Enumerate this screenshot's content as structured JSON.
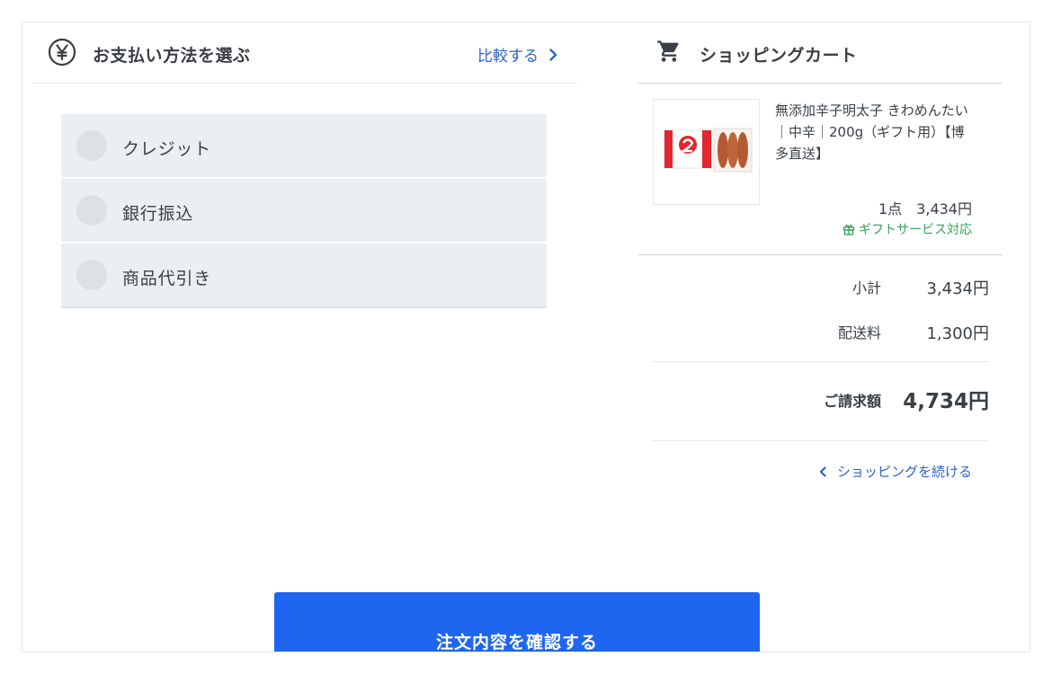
{
  "payment": {
    "title": "お支払い方法を選ぶ",
    "compare_label": "比較する",
    "options": [
      {
        "label": "クレジット"
      },
      {
        "label": "銀行振込"
      },
      {
        "label": "商品代引き"
      }
    ]
  },
  "cart": {
    "title": "ショッピングカート",
    "product": {
      "name": "無添加辛子明太子 きわめんたい｜中辛｜200g（ギフト用）【博多直送】",
      "quantity_price": "1点　3,434円",
      "gift_service": "ギフトサービス対応"
    },
    "subtotal_label": "小計",
    "subtotal_value": "3,434円",
    "shipping_label": "配送料",
    "shipping_value": "1,300円",
    "total_label": "ご請求額",
    "total_value": "4,734円",
    "continue_label": "ショッピングを続ける"
  },
  "confirm_label": "注文内容を確認する",
  "colors": {
    "primary_button": "#1e66f0",
    "link": "#2e64c9",
    "gift_green": "#3aa05a",
    "option_bg": "#eceff1"
  },
  "icons": {
    "payment": "yen-icon",
    "compare": "chevron-right-icon",
    "cart": "cart-icon",
    "gift": "gift-icon",
    "continue": "chevron-left-icon"
  }
}
